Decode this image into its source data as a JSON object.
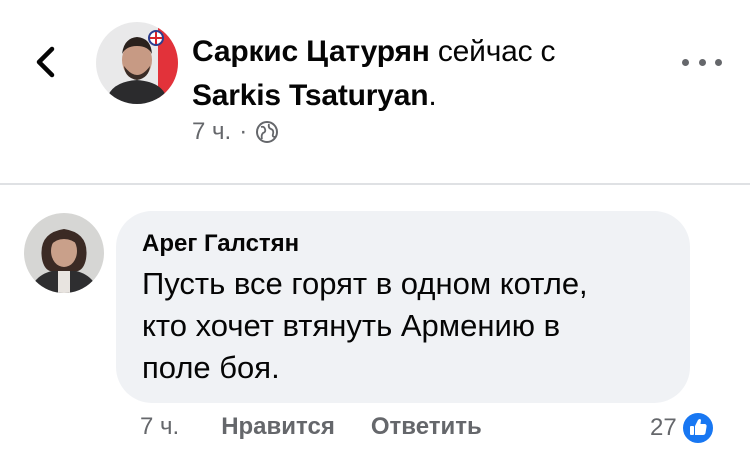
{
  "post": {
    "author_name": "Саркис Цатурян",
    "action_text": "сейчас с",
    "shared_with": "Sarkis Tsaturyan",
    "shared_suffix": ".",
    "time": "7 ч.",
    "separator": "·",
    "privacy_icon": "globe-icon"
  },
  "comment": {
    "author_name": "Арег Галстян",
    "text_lines": [
      "Пусть все горят в одном котле,",
      "кто хочет втянуть Армению в",
      "поле боя."
    ],
    "time": "7 ч.",
    "like_label": "Нравится",
    "reply_label": "Ответить",
    "reaction_count": "27",
    "reaction_icon": "thumbs-up-icon"
  },
  "colors": {
    "secondary_text": "#65676b",
    "bubble_bg": "#f0f2f5",
    "like_blue": "#1877f2"
  }
}
